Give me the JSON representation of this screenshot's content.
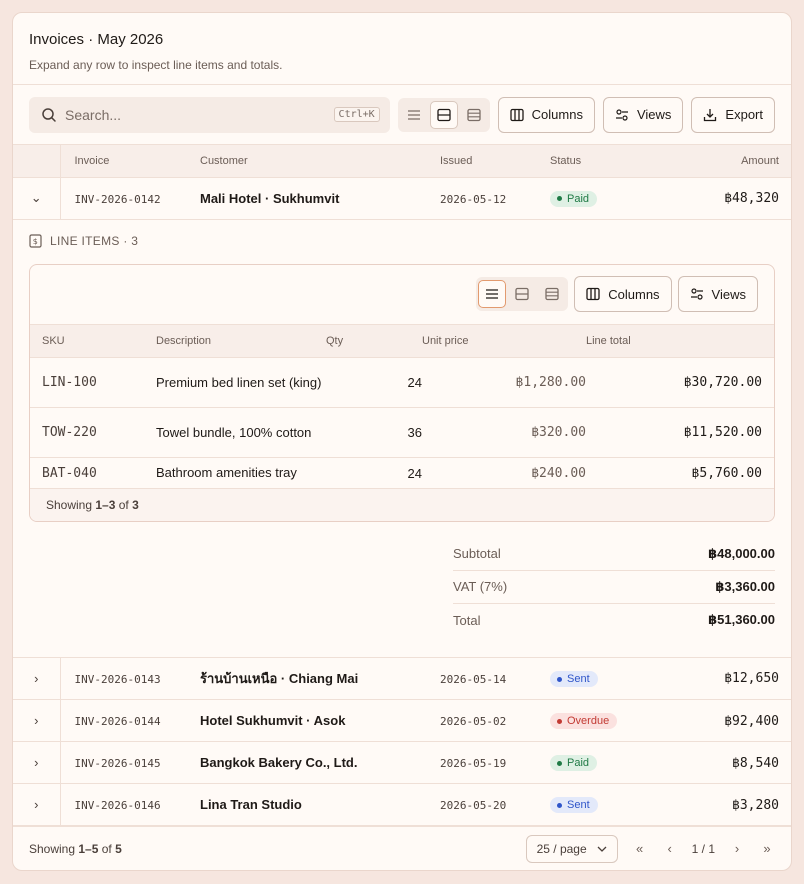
{
  "header": {
    "title": "Invoices · May 2026",
    "subtitle": "Expand any row to inspect line items and totals."
  },
  "toolbar": {
    "search_placeholder": "Search...",
    "shortcut": "Ctrl+K",
    "columns_label": "Columns",
    "views_label": "Views",
    "export_label": "Export"
  },
  "table": {
    "headers": {
      "invoice": "Invoice",
      "customer": "Customer",
      "issued": "Issued",
      "status": "Status",
      "amount": "Amount"
    },
    "rows": [
      {
        "id": "INV-2026-0142",
        "customer": "Mali Hotel · Sukhumvit",
        "issued": "2026-05-12",
        "status": "Paid",
        "amount": "฿48,320"
      },
      {
        "id": "INV-2026-0143",
        "customer": "ร้านบ้านเหนือ · Chiang Mai",
        "issued": "2026-05-14",
        "status": "Sent",
        "amount": "฿12,650"
      },
      {
        "id": "INV-2026-0144",
        "customer": "Hotel Sukhumvit · Asok",
        "issued": "2026-05-02",
        "status": "Overdue",
        "amount": "฿92,400"
      },
      {
        "id": "INV-2026-0145",
        "customer": "Bangkok Bakery Co., Ltd.",
        "issued": "2026-05-19",
        "status": "Paid",
        "amount": "฿8,540"
      },
      {
        "id": "INV-2026-0146",
        "customer": "Lina Tran Studio",
        "issued": "2026-05-20",
        "status": "Sent",
        "amount": "฿3,280"
      }
    ]
  },
  "line_items": {
    "label": "LINE ITEMS · 3",
    "columns_label": "Columns",
    "views_label": "Views",
    "headers": {
      "sku": "SKU",
      "description": "Description",
      "qty": "Qty",
      "unit_price": "Unit price",
      "line_total": "Line total"
    },
    "rows": [
      {
        "sku": "LIN-100",
        "description": "Premium bed linen set (king)",
        "qty": "24",
        "unit_price": "฿1,280.00",
        "line_total": "฿30,720.00"
      },
      {
        "sku": "TOW-220",
        "description": "Towel bundle, 100% cotton",
        "qty": "36",
        "unit_price": "฿320.00",
        "line_total": "฿11,520.00"
      },
      {
        "sku": "BAT-040",
        "description": "Bathroom amenities tray",
        "qty": "24",
        "unit_price": "฿240.00",
        "line_total": "฿5,760.00"
      }
    ],
    "footer": {
      "prefix": "Showing ",
      "range": "1–3",
      "of": " of ",
      "total": "3"
    }
  },
  "totals": [
    {
      "label": "Subtotal",
      "value": "฿48,000.00"
    },
    {
      "label": "VAT (7%)",
      "value": "฿3,360.00"
    },
    {
      "label": "Total",
      "value": "฿51,360.00"
    }
  ],
  "footer": {
    "prefix": "Showing ",
    "range": "1–5",
    "of": " of ",
    "total": "5",
    "per_page": "25 / page",
    "page": "1 / 1"
  },
  "colors": {
    "paid_bg": "#dff0e4",
    "paid_fg": "#1f7a45",
    "sent_bg": "#e3e9fa",
    "sent_fg": "#2f55c9",
    "overdue_bg": "#fbe1df",
    "overdue_fg": "#c23a33"
  }
}
